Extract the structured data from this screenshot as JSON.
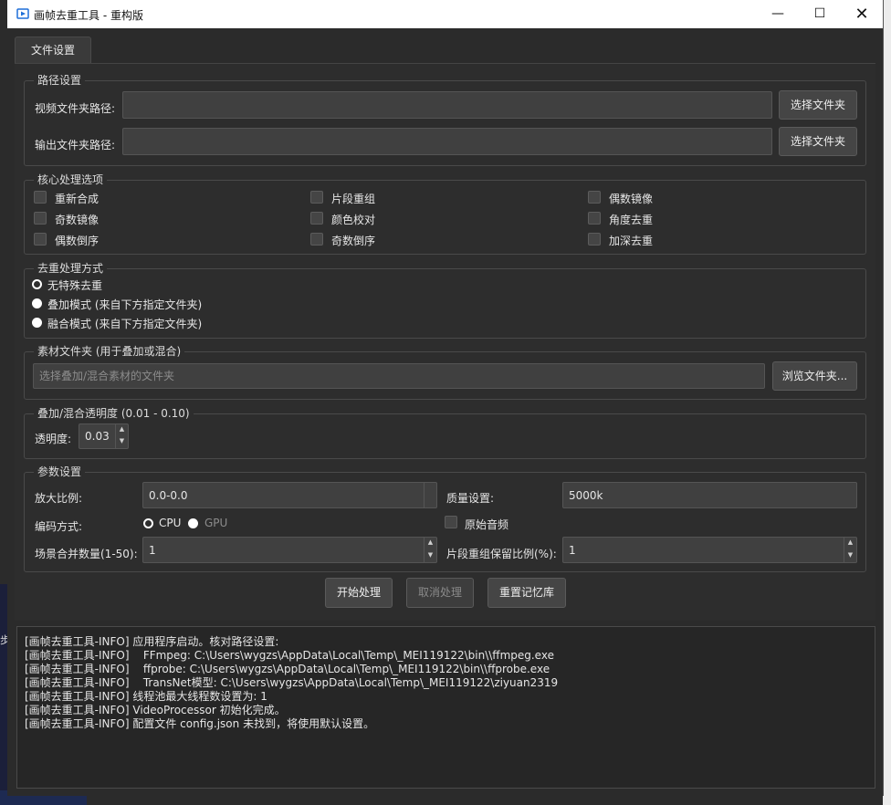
{
  "window": {
    "title": "画帧去重工具 - 重构版",
    "min_glyph": "—",
    "max_glyph": "☐",
    "close_glyph": "✕"
  },
  "tabs": [
    {
      "label": "文件设置"
    }
  ],
  "path_settings": {
    "title": "路径设置",
    "video_label": "视频文件夹路径:",
    "video_value": "",
    "output_label": "输出文件夹路径:",
    "output_value": "",
    "browse_label": "选择文件夹"
  },
  "core_options": {
    "title": "核心处理选项",
    "items": [
      "重新合成",
      "片段重组",
      "偶数镜像",
      "奇数镜像",
      "颜色校对",
      "角度去重",
      "偶数倒序",
      "奇数倒序",
      "加深去重"
    ]
  },
  "dedup_mode": {
    "title": "去重处理方式",
    "options": [
      "无特殊去重",
      "叠加模式 (来自下方指定文件夹)",
      "融合模式 (来自下方指定文件夹)"
    ],
    "selected": 0
  },
  "material_folder": {
    "title": "素材文件夹 (用于叠加或混合)",
    "placeholder": "选择叠加/混合素材的文件夹",
    "browse_label": "浏览文件夹..."
  },
  "opacity": {
    "title": "叠加/混合透明度 (0.01 - 0.10)",
    "label": "透明度:",
    "value": "0.03"
  },
  "params": {
    "title": "参数设置",
    "scale_label": "放大比例:",
    "scale_value": "0.0-0.0",
    "quality_label": "质量设置:",
    "quality_value": "5000k",
    "encode_label": "编码方式:",
    "encode_cpu": "CPU",
    "encode_gpu": "GPU",
    "original_audio_label": "原始音频",
    "scene_merge_label": "场景合并数量(1-50):",
    "scene_merge_value": "1",
    "segment_keep_label": "片段重组保留比例(%):",
    "segment_keep_value": "1"
  },
  "actions": {
    "start": "开始处理",
    "cancel": "取消处理",
    "reset": "重置记忆库"
  },
  "log_lines": [
    "[画帧去重工具-INFO] 应用程序启动。核对路径设置:",
    "[画帧去重工具-INFO]    FFmpeg: C:\\Users\\wygzs\\AppData\\Local\\Temp\\_MEI119122\\bin\\\\ffmpeg.exe",
    "[画帧去重工具-INFO]    ffprobe: C:\\Users\\wygzs\\AppData\\Local\\Temp\\_MEI119122\\bin\\\\ffprobe.exe",
    "[画帧去重工具-INFO]    TransNet模型: C:\\Users\\wygzs\\AppData\\Local\\Temp\\_MEI119122\\ziyuan2319",
    "[画帧去重工具-INFO] 线程池最大线程数设置为: 1",
    "[画帧去重工具-INFO] VideoProcessor 初始化完成。",
    "[画帧去重工具-INFO] 配置文件 config.json 未找到，将使用默认设置。"
  ],
  "desktop": {
    "left_glyph": "步"
  },
  "colors": {
    "accent": "#1e6fd9",
    "background": "#2b2b2b",
    "field": "#404040"
  }
}
